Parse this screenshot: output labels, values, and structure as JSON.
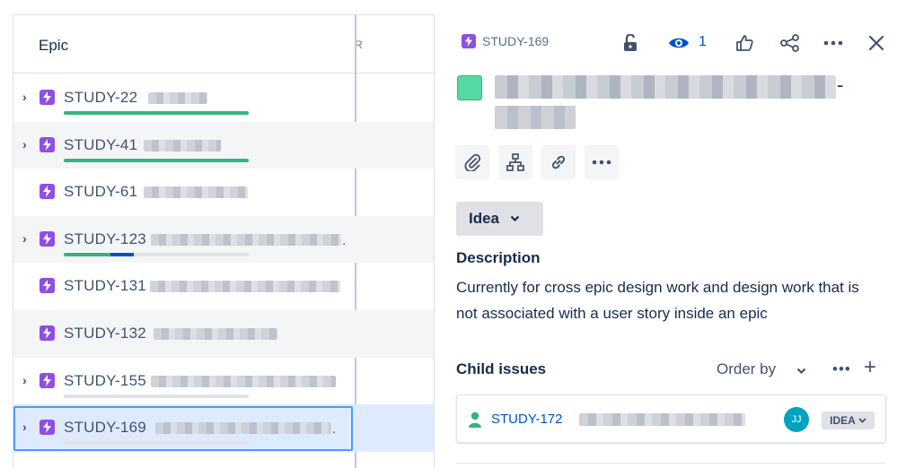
{
  "epic_panel": {
    "column_title": "Epic",
    "next_column_fragment": "R",
    "rows": [
      {
        "key": "STUDY-22",
        "expandable": true,
        "progress": {
          "done": 1.0,
          "in_progress": 0.0
        }
      },
      {
        "key": "STUDY-41",
        "expandable": true,
        "progress": {
          "done": 1.0,
          "in_progress": 0.0
        }
      },
      {
        "key": "STUDY-61",
        "expandable": false,
        "progress": null
      },
      {
        "key": "STUDY-123",
        "expandable": true,
        "progress": {
          "done": 0.25,
          "in_progress": 0.13
        }
      },
      {
        "key": "STUDY-131",
        "expandable": false,
        "progress": null
      },
      {
        "key": "STUDY-132",
        "expandable": false,
        "progress": null
      },
      {
        "key": "STUDY-155",
        "expandable": true,
        "progress": {
          "done": 0.0,
          "in_progress": 0.0
        }
      },
      {
        "key": "STUDY-169",
        "expandable": true,
        "progress": {
          "done": 0.0,
          "in_progress": 0.0
        },
        "selected": true
      }
    ],
    "ellipsis": "."
  },
  "detail": {
    "issue_key": "STUDY-169",
    "watchers_count": "1",
    "title_trailing": "-",
    "status_button": "Idea",
    "description_label": "Description",
    "description_text": "Currently for cross epic design work and design work that is not associated with a user story inside an epic",
    "child_issues_label": "Child issues",
    "order_by_label": "Order by",
    "child_more": "•••",
    "child_add": "+",
    "child": {
      "key": "STUDY-172",
      "assignee_initials": "JJ",
      "status": "IDEA"
    }
  },
  "icons": {
    "header_actions": [
      "unlock-icon",
      "watch-eye-icon",
      "thumbs-up-icon",
      "share-icon",
      "more-icon",
      "close-icon"
    ],
    "tools": [
      "attachment-icon",
      "child-hierarchy-icon",
      "link-icon",
      "more-icon"
    ]
  },
  "colors": {
    "epic_purple": "#904ee2",
    "done_green": "#36b37e",
    "in_progress_blue": "#0052cc",
    "selected_row": "#deebff",
    "selection_outline": "#4c9aff",
    "title_swatch": "#57d9a3",
    "avatar_teal": "#00a3bf"
  }
}
